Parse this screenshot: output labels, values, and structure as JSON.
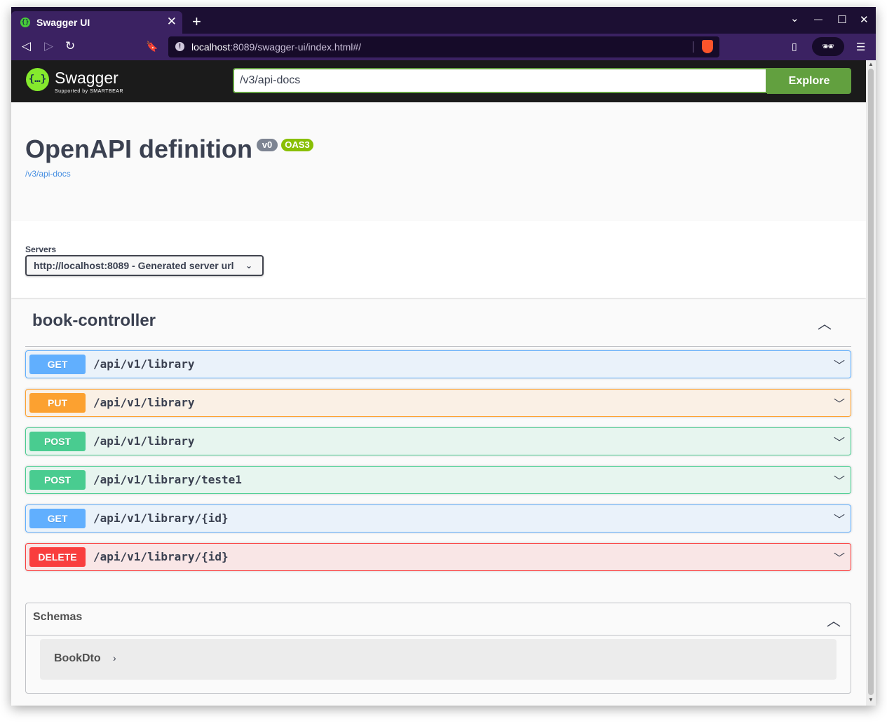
{
  "browser": {
    "tab_title": "Swagger UI",
    "favicon_glyph": "{}",
    "close_glyph": "✕",
    "new_tab_glyph": "+",
    "url_host": "localhost",
    "url_rest": ":8089/swagger-ui/index.html#/",
    "info_glyph": "!",
    "window_controls": {
      "dropdown": "⌄",
      "minimize": "—",
      "maximize": "☐",
      "close": "✕"
    },
    "nav": {
      "back": "◁",
      "forward": "▷",
      "reload": "↻",
      "bookmark": "🔖",
      "sidebar": "▯",
      "menu": "☰",
      "reader": "🕶"
    }
  },
  "swagger": {
    "logo_glyph": "{…}",
    "brand": "Swagger",
    "supported_by": "Supported by SMARTBEAR",
    "spec_url": "/v3/api-docs",
    "explore_label": "Explore"
  },
  "info": {
    "title": "OpenAPI definition",
    "version": "v0",
    "oas": "OAS3",
    "spec_link": "/v3/api-docs"
  },
  "servers": {
    "label": "Servers",
    "selected": "http://localhost:8089 - Generated server url",
    "chevron": "⌄"
  },
  "tag": {
    "name": "book-controller",
    "toggle": "︿",
    "operations": [
      {
        "method": "GET",
        "path": "/api/v1/library"
      },
      {
        "method": "PUT",
        "path": "/api/v1/library"
      },
      {
        "method": "POST",
        "path": "/api/v1/library"
      },
      {
        "method": "POST",
        "path": "/api/v1/library/teste1"
      },
      {
        "method": "GET",
        "path": "/api/v1/library/{id}"
      },
      {
        "method": "DELETE",
        "path": "/api/v1/library/{id}"
      }
    ],
    "op_chevron": "﹀"
  },
  "schemas": {
    "title": "Schemas",
    "toggle": "︿",
    "models": [
      {
        "name": "BookDto",
        "arrow": "›"
      }
    ]
  },
  "colors": {
    "get": "#61affe",
    "put": "#fca130",
    "post": "#49cc90",
    "delete": "#f93e3e",
    "explore": "#62a03f",
    "oas_badge": "#89bf04"
  }
}
